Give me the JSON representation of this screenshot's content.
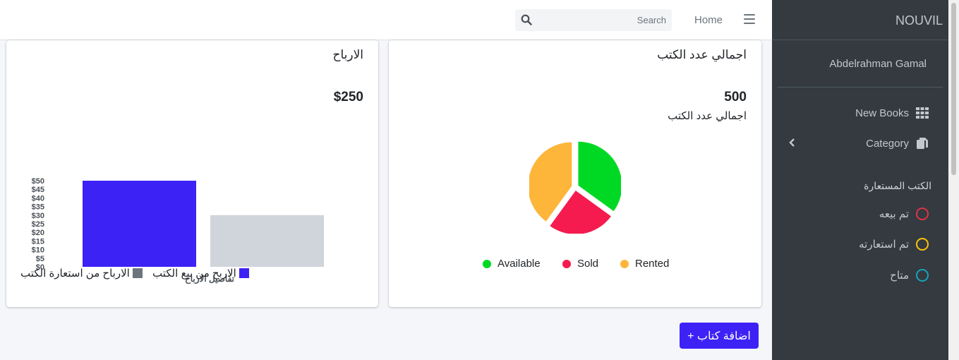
{
  "navbar": {
    "home_label": "Home",
    "search_placeholder": "Search"
  },
  "sidebar": {
    "brand": "NOUVIL",
    "user_name": "Abdelrahman Gamal",
    "items": [
      {
        "label": "New Books",
        "icon": "grid-icon"
      },
      {
        "label": "Category",
        "icon": "copy-icon"
      }
    ],
    "section_header": "الكتب المستعارة",
    "status_items": [
      {
        "label": "تم بيعه",
        "color": "#dc3545"
      },
      {
        "label": "تم استعارته",
        "color": "#ffc107"
      },
      {
        "label": "متاح",
        "color": "#17a2b8"
      }
    ]
  },
  "books_card": {
    "title": "اجمالي عدد الكتب",
    "total": "500",
    "subtitle": "اجمالي عدد الكتب"
  },
  "profit_card": {
    "title": "الارباح",
    "total": "$250",
    "legend": [
      {
        "label": "الاربح من بيع الكتب",
        "color": "#3d22f6"
      },
      {
        "label": "الارباح من استعارة الكتب",
        "color": "#6c757d"
      }
    ]
  },
  "add_button_label": "+ اضافة كتاب",
  "chart_data": [
    {
      "type": "pie",
      "labels": [
        "Available",
        "Sold",
        "Rented"
      ],
      "values": [
        35,
        25,
        40
      ],
      "colors": [
        "#00d924",
        "#f51b4e",
        "#fdb53a"
      ],
      "legend_position": "bottom"
    },
    {
      "type": "bar",
      "categories": [
        "تفاصيل الارباح"
      ],
      "xlabel": "تفاصيل الارباح",
      "series": [
        {
          "name": "الاربح من بيع الكتب",
          "values": [
            50
          ],
          "color": "#3d22f6"
        },
        {
          "name": "الارباح من استعارة الكتب",
          "values": [
            30
          ],
          "color": "#d0d4db"
        }
      ],
      "ylim": [
        0,
        50
      ],
      "yticks": [
        "$0",
        "$5",
        "$10",
        "$15",
        "$20",
        "$25",
        "$30",
        "$35",
        "$40",
        "$45",
        "$50"
      ],
      "legend_position": "bottom"
    }
  ]
}
